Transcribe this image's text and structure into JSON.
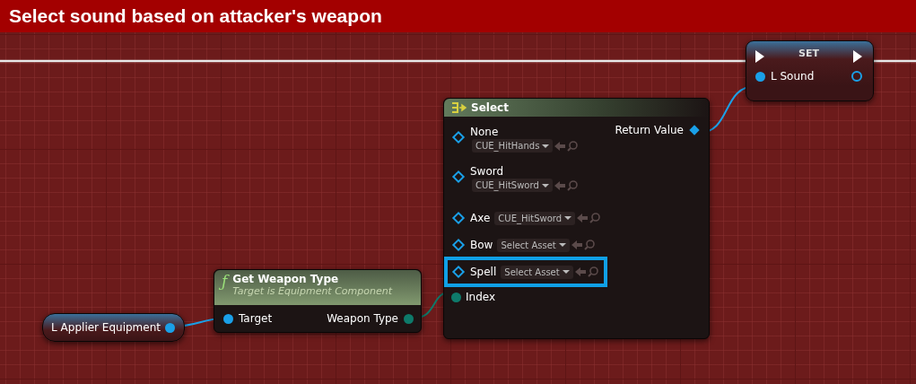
{
  "graph_title": "Select sound based on attacker's weapon",
  "set_node": {
    "title": "SET",
    "input_label": "L Sound"
  },
  "select_node": {
    "title": "Select",
    "output_label": "Return Value",
    "index_label": "Index",
    "options": [
      {
        "label": "None",
        "value": "CUE_HitHands",
        "kind": "stacked",
        "highlighted": false
      },
      {
        "label": "Sword",
        "value": "CUE_HitSword",
        "kind": "stacked",
        "highlighted": false
      },
      {
        "label": "Axe",
        "value": "CUE_HitSword",
        "kind": "inline",
        "highlighted": false
      },
      {
        "label": "Bow",
        "value": "Select Asset",
        "kind": "inline",
        "highlighted": false
      },
      {
        "label": "Spell",
        "value": "Select Asset",
        "kind": "inline",
        "highlighted": true
      }
    ]
  },
  "function_node": {
    "icon": "ƒ",
    "title": "Get Weapon Type",
    "subtitle": "Target is Equipment Component",
    "input_label": "Target",
    "output_label": "Weapon Type"
  },
  "variable_node": {
    "label": "L Applier Equipment"
  }
}
